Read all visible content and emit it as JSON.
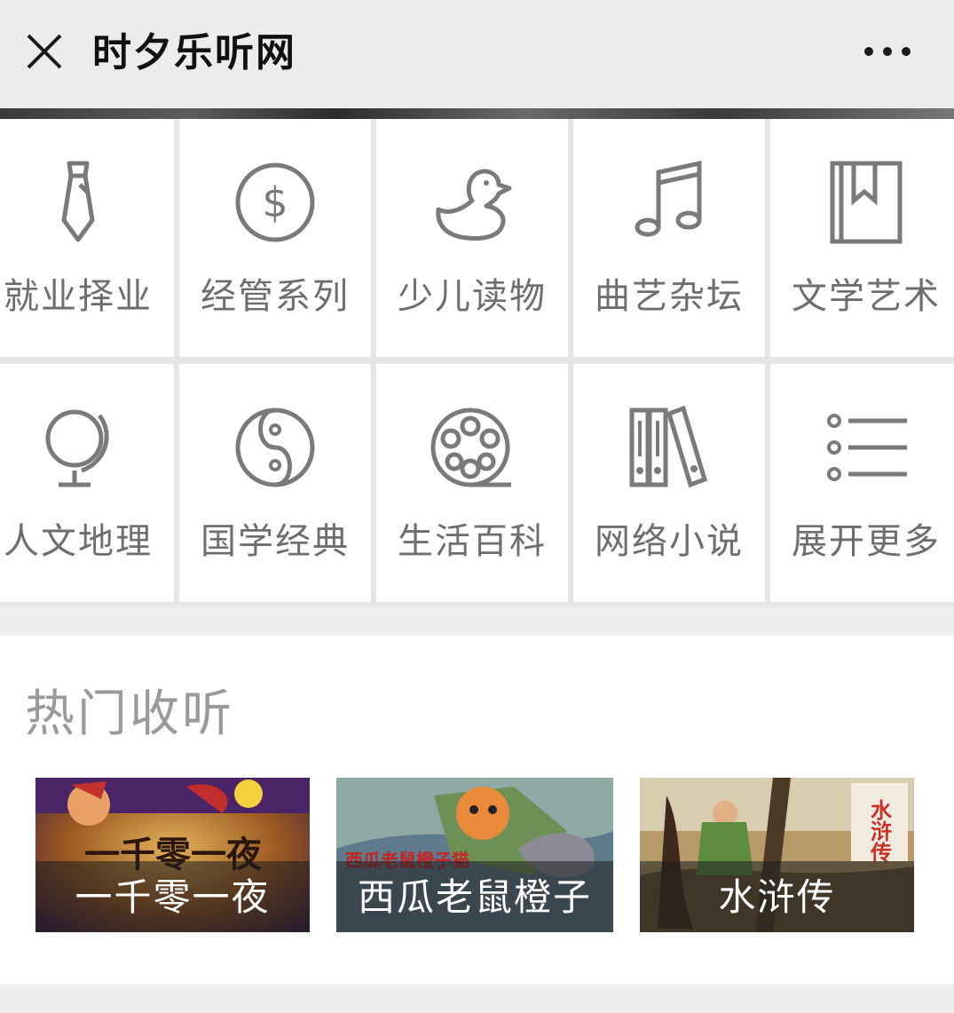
{
  "header": {
    "title": "时夕乐听网",
    "close_icon": "close-icon",
    "more_icon": "more-dots-icon"
  },
  "categories": [
    {
      "label": "就业择业",
      "icon": "necktie-icon"
    },
    {
      "label": "经管系列",
      "icon": "dollar-coin-icon"
    },
    {
      "label": "少儿读物",
      "icon": "duck-icon"
    },
    {
      "label": "曲艺杂坛",
      "icon": "music-note-icon"
    },
    {
      "label": "文学艺术",
      "icon": "book-icon"
    },
    {
      "label": "人文地理",
      "icon": "globe-icon"
    },
    {
      "label": "国学经典",
      "icon": "yin-yang-icon"
    },
    {
      "label": "生活百科",
      "icon": "film-reel-icon"
    },
    {
      "label": "网络小说",
      "icon": "binders-icon"
    },
    {
      "label": "展开更多",
      "icon": "list-icon"
    }
  ],
  "hot": {
    "title": "热门收听",
    "items": [
      {
        "title": "一千零一夜",
        "art_text": "一千零一夜"
      },
      {
        "title": "西瓜老鼠橙子",
        "art_text": "西瓜老鼠橙子猫"
      },
      {
        "title": "水浒传",
        "art_text": "水浒传"
      }
    ]
  },
  "colors": {
    "icon_gray": "#7a7a7a",
    "label_gray": "#6e6e6e",
    "section_title_gray": "#9a9a9a"
  }
}
